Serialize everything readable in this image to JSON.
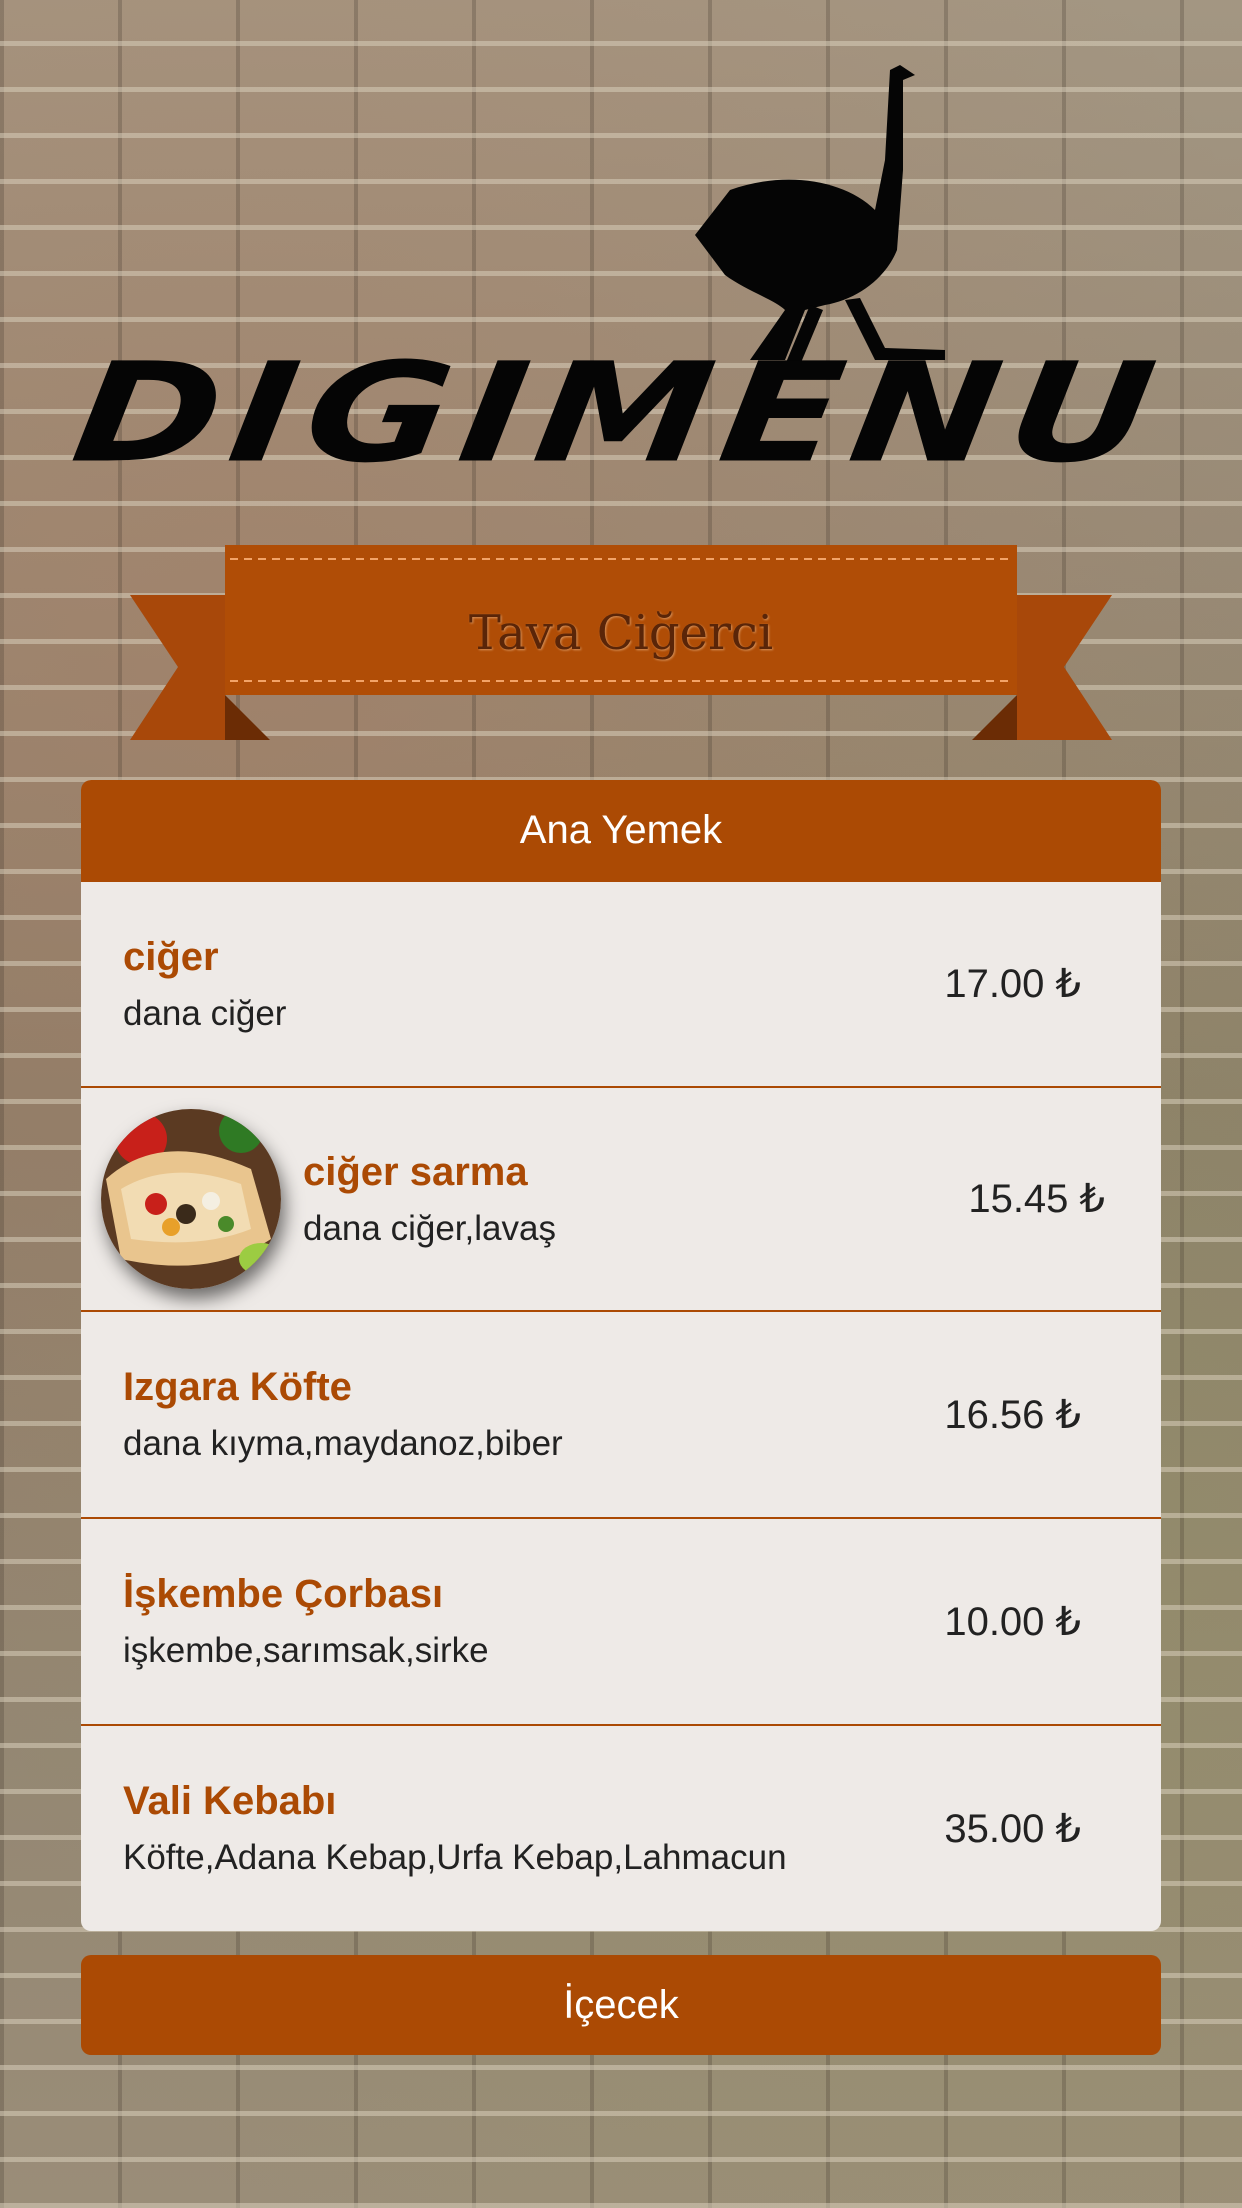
{
  "brand": {
    "logo_text": "DIGIMENU",
    "logo_icon": "ostrich-icon"
  },
  "restaurant": {
    "name": "Tava Ciğerci"
  },
  "colors": {
    "accent": "#ab4a04",
    "card_background": "#eeeae7",
    "text": "#222222"
  },
  "categories": [
    {
      "title": "Ana Yemek",
      "items": [
        {
          "name": "ciğer",
          "description": "dana ciğer",
          "price": "17.00 ₺",
          "has_image": false
        },
        {
          "name": "ciğer sarma",
          "description": "dana ciğer,lavaş",
          "price": "15.45 ₺",
          "has_image": true,
          "image": "wrap-photo"
        },
        {
          "name": "Izgara Köfte",
          "description": "dana kıyma,maydanoz,biber",
          "price": "16.56 ₺",
          "has_image": false
        },
        {
          "name": "İşkembe Çorbası",
          "description": "işkembe,sarımsak,sirke",
          "price": "10.00 ₺",
          "has_image": false
        },
        {
          "name": "Vali Kebabı",
          "description": "Köfte,Adana Kebap,Urfa Kebap,Lahmacun",
          "price": "35.00 ₺",
          "has_image": false
        }
      ]
    },
    {
      "title": "İçecek"
    }
  ]
}
